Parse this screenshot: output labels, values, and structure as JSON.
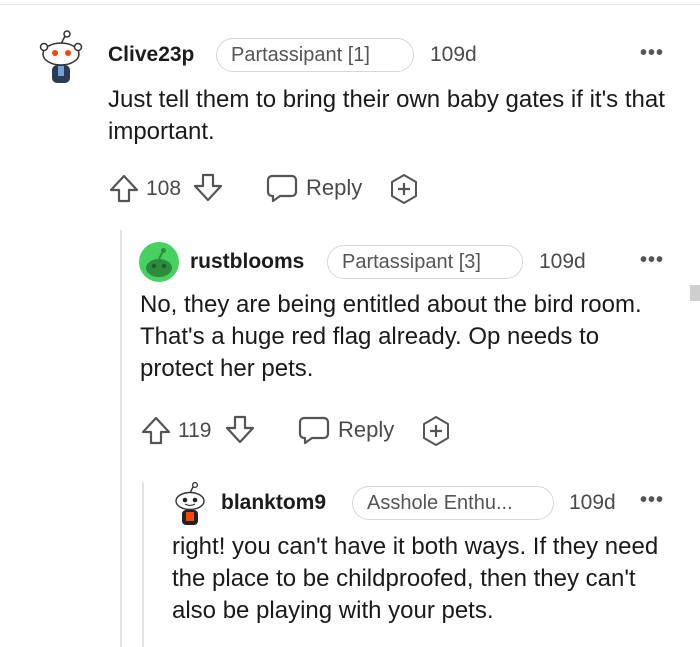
{
  "comments": [
    {
      "username": "Clive23p",
      "flair": "Partassipant [1]",
      "age": "109d",
      "more_icon": "ellipsis-icon",
      "text": "Just tell them to bring their own baby gates if it's that important.",
      "votes": "108",
      "reply_label": "Reply",
      "avatar_color": "#ff4500"
    },
    {
      "username": "rustblooms",
      "flair": "Partassipant [3]",
      "age": "109d",
      "more_icon": "ellipsis-icon",
      "text": "No, they are being entitled about the bird room. That's a huge red flag already. Op needs to protect her pets.",
      "votes": "119",
      "reply_label": "Reply",
      "avatar_color": "#46d160"
    },
    {
      "username": "blanktom9",
      "flair": "Asshole Enthu...",
      "age": "109d",
      "more_icon": "ellipsis-icon",
      "text": "right! you can't have it both ways. If they need the place to be childproofed, then they can't also be playing with your pets.",
      "avatar_color": "#ff4500"
    }
  ],
  "more_label": "•••"
}
